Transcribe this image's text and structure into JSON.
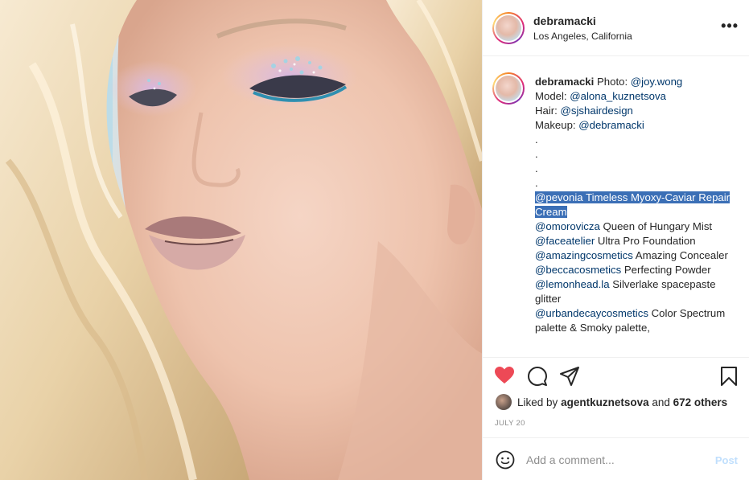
{
  "post": {
    "username": "debramacki",
    "location": "Los Angeles, California",
    "more_icon": "more-horizontal-icon"
  },
  "caption": {
    "username": "debramacki",
    "line1_text": "Photo: ",
    "line1_mention": "@joy.wong",
    "line2_text": "Model: ",
    "line2_mention": "@alona_kuznetsova",
    "line3_text": "Hair: ",
    "line3_mention": "@sjshairdesign",
    "line4_text": "Makeup: ",
    "line4_mention": "@debramacki",
    "dots": [
      ".",
      ".",
      ".",
      "."
    ],
    "products": [
      {
        "mention": "@pevonia",
        "text": " Timeless Myoxy-Caviar Repair Cream",
        "highlighted": true
      },
      {
        "mention": "@omorovicza",
        "text": " Queen of Hungary Mist"
      },
      {
        "mention": "@faceatelier",
        "text": " Ultra Pro Foundation"
      },
      {
        "mention": "@amazingcosmetics",
        "text": " Amazing Concealer"
      },
      {
        "mention": "@beccacosmetics",
        "text": " Perfecting Powder"
      },
      {
        "mention": "@lemonhead.la",
        "text": " Silverlake spacepaste glitter"
      },
      {
        "mention": "@urbandecaycosmetics",
        "text": " Color Spectrum palette & Smoky palette,"
      }
    ]
  },
  "actions": {
    "like_icon": "heart-icon",
    "comment_icon": "comment-icon",
    "share_icon": "share-icon",
    "save_icon": "bookmark-icon",
    "like_color": "#ed4956"
  },
  "likes": {
    "prefix": "Liked by ",
    "user": "agentkuznetsova",
    "middle": " and ",
    "count": "672 others"
  },
  "date": "JULY 20",
  "comment": {
    "placeholder": "Add a comment...",
    "post_label": "Post",
    "emoji_icon": "emoji-icon"
  }
}
